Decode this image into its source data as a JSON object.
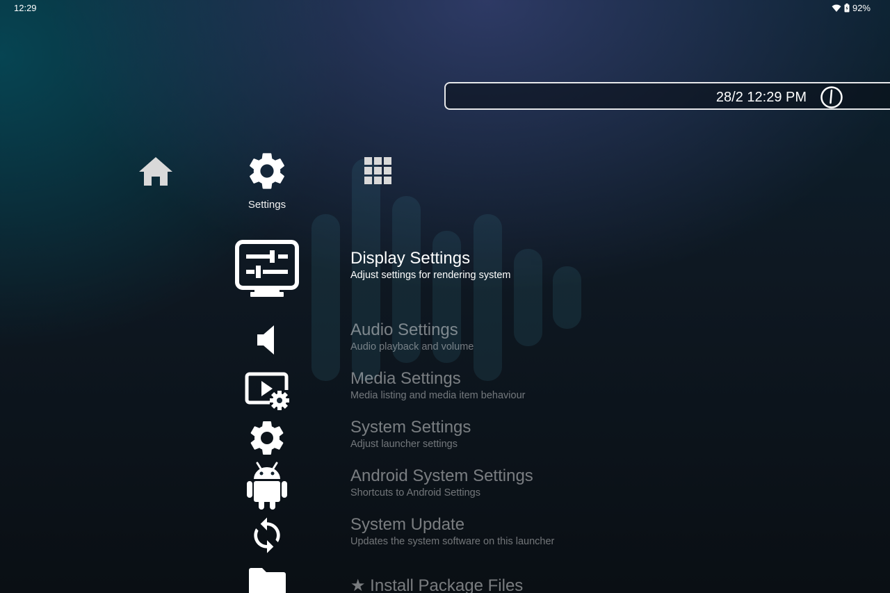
{
  "status_bar": {
    "time": "12:29",
    "battery_percent": "92%",
    "icons": [
      "wifi-icon",
      "battery-icon"
    ]
  },
  "clock": {
    "datetime": "28/2 12:29 PM",
    "icon": "power-icon"
  },
  "top_nav": {
    "items": [
      {
        "icon": "home-icon",
        "label": ""
      },
      {
        "icon": "gear-icon",
        "label": "Settings",
        "selected": true
      },
      {
        "icon": "apps-grid-icon",
        "label": ""
      }
    ]
  },
  "settings_menu": {
    "items": [
      {
        "icon": "display-settings-icon",
        "title": "Display Settings",
        "description": "Adjust settings for rendering system",
        "selected": true
      },
      {
        "icon": "speaker-icon",
        "title": "Audio Settings",
        "description": "Audio playback and volume"
      },
      {
        "icon": "media-settings-icon",
        "title": "Media Settings",
        "description": "Media listing and media item behaviour"
      },
      {
        "icon": "gear-icon",
        "title": "System Settings",
        "description": "Adjust launcher settings"
      },
      {
        "icon": "android-icon",
        "title": "Android System Settings",
        "description": "Shortcuts to Android Settings"
      },
      {
        "icon": "sync-icon",
        "title": "System Update",
        "description": "Updates the system software on this launcher"
      },
      {
        "icon": "folder-icon",
        "title": "★ Install Package Files",
        "description": ""
      }
    ]
  },
  "colors": {
    "text_primary": "#ffffff",
    "text_dimmed": "rgba(255,255,255,0.45)",
    "background_top_left": "#06464f",
    "background_center": "#343e6e",
    "background_bottom": "#0a0f14"
  }
}
